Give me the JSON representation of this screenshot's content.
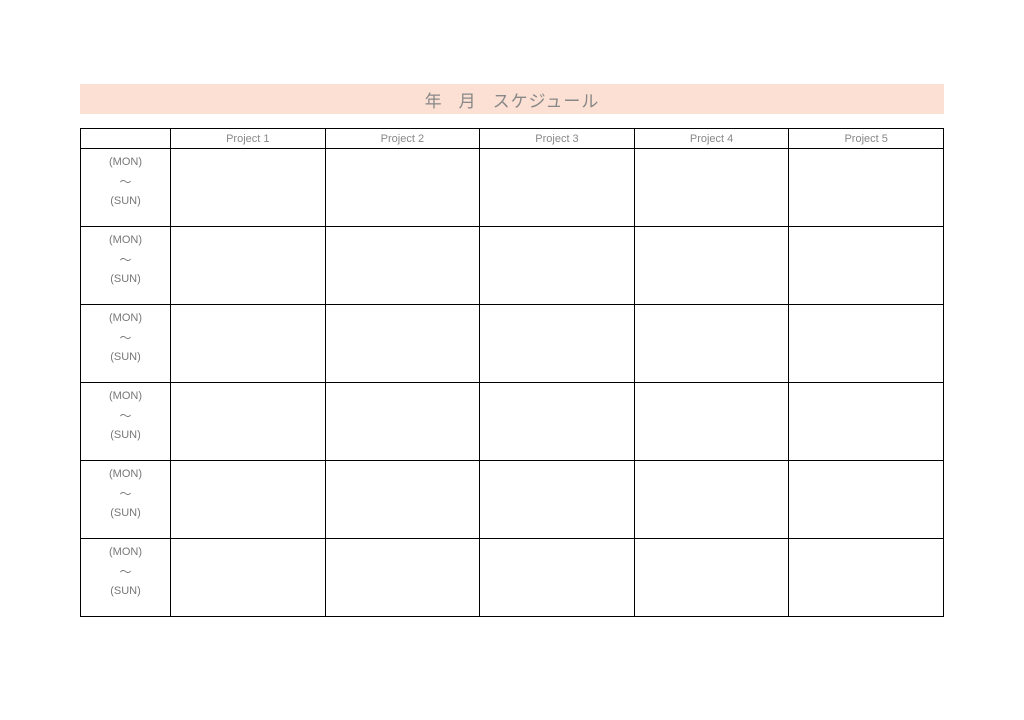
{
  "title": {
    "year_label": "年",
    "month_label": "月",
    "schedule_label": "スケジュール"
  },
  "columns": [
    "Project 1",
    "Project 2",
    "Project 3",
    "Project 4",
    "Project 5"
  ],
  "week_labels": {
    "mon_paren": "(MON)",
    "tilde": "～",
    "sun_paren": "(SUN)"
  },
  "row_count": 6
}
